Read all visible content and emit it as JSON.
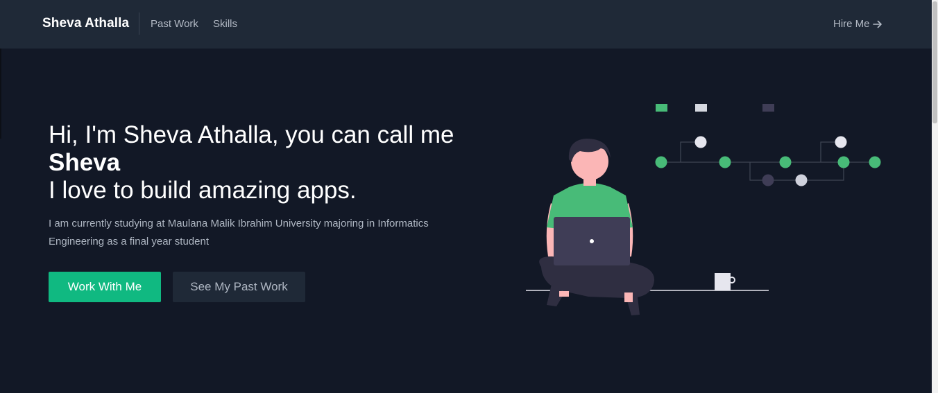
{
  "nav": {
    "brand": "Sheva Athalla",
    "links": [
      {
        "label": "Past Work"
      },
      {
        "label": "Skills"
      }
    ],
    "hire": "Hire Me"
  },
  "hero": {
    "title_line1": "Hi, I'm Sheva Athalla, you can call me ",
    "title_name": "Sheva",
    "title_line2": "I love to build amazing apps.",
    "subtitle": "I am currently studying at Maulana Malik Ibrahim University majoring in Informatics Engineering as a final year student",
    "primary_button": "Work With Me",
    "secondary_button": "See My Past Work"
  },
  "colors": {
    "background": "#121826",
    "navbar": "#1f2937",
    "accent": "#10b981",
    "illustration_green": "#48bb78"
  },
  "icons": {
    "hire_arrow": "arrow-right-icon"
  }
}
